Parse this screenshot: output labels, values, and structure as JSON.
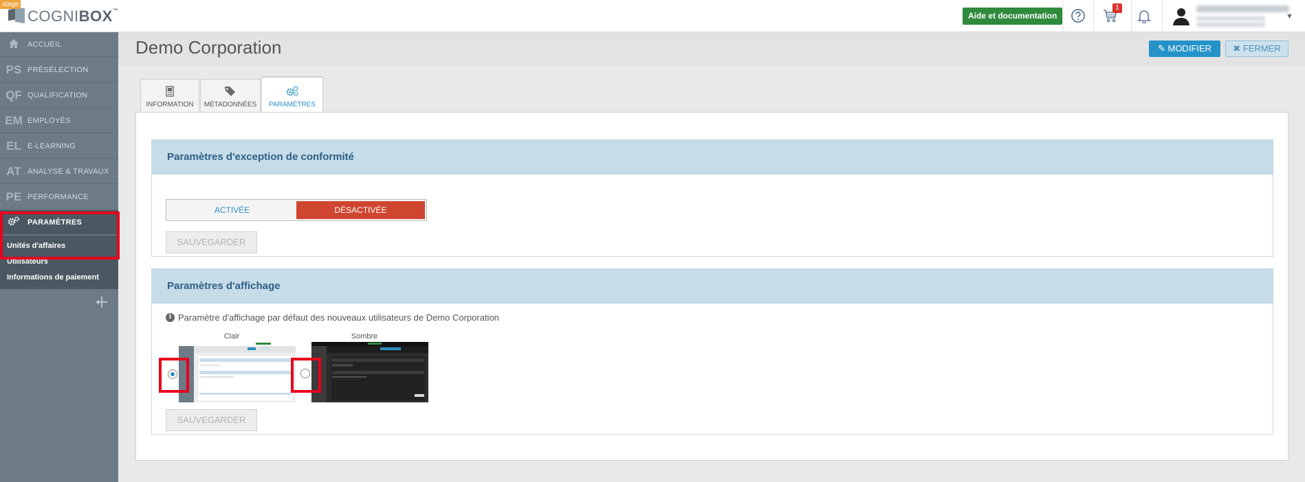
{
  "env_badge": "stage",
  "logo": {
    "brand_bold": "COGNI",
    "brand_light": "BOX",
    "tm": "™"
  },
  "topbar": {
    "help_label": "Aide et documentation",
    "cart_count": "1"
  },
  "sidebar": {
    "items": [
      {
        "abbr": "",
        "label": "ACCUEIL",
        "icon": "home-icon"
      },
      {
        "abbr": "PS",
        "label": "PRÉSÉLECTION"
      },
      {
        "abbr": "QF",
        "label": "QUALIFICATION"
      },
      {
        "abbr": "EM",
        "label": "EMPLOYÉS"
      },
      {
        "abbr": "EL",
        "label": "E-LEARNING"
      },
      {
        "abbr": "AT",
        "label": "ANALYSE & TRAVAUX"
      },
      {
        "abbr": "PE",
        "label": "PERFORMANCE"
      },
      {
        "abbr": "",
        "label": "PARAMÈTRES",
        "icon": "gears-icon"
      }
    ],
    "sub_items": [
      {
        "label": "Unités d'affaires"
      },
      {
        "label": "Utilisateurs"
      },
      {
        "label": "Informations de paiement"
      }
    ]
  },
  "header": {
    "title": "Demo Corporation",
    "modifier_label": "MODIFIER",
    "fermer_label": "FERMER"
  },
  "tabs": [
    {
      "label": "INFORMATION",
      "icon": "document-icon"
    },
    {
      "label": "MÉTADONNÉES",
      "icon": "tags-icon"
    },
    {
      "label": "PARAMÈTRES",
      "icon": "gears-icon",
      "active": true
    }
  ],
  "compliance": {
    "title": "Paramètres d'exception de conformité",
    "option_on": "ACTIVÉE",
    "option_off": "DÉSACTIVÉE",
    "selected": "DÉSACTIVÉE",
    "save_label": "SAUVEGARDER"
  },
  "display": {
    "title": "Paramètres d'affichage",
    "info": "Paramètre d'affichage par défaut des nouveaux utilisateurs de Demo Corporation",
    "light_label": "Clair",
    "dark_label": "Sombre",
    "selected": "Clair",
    "save_label": "SAUVEGARDER"
  },
  "colors": {
    "accent": "#2a8fc1",
    "help_button": "#2f8a3c",
    "toggle_off": "#cf4530",
    "sidebar": "#6c7b86",
    "highlight": "#e8001c"
  }
}
